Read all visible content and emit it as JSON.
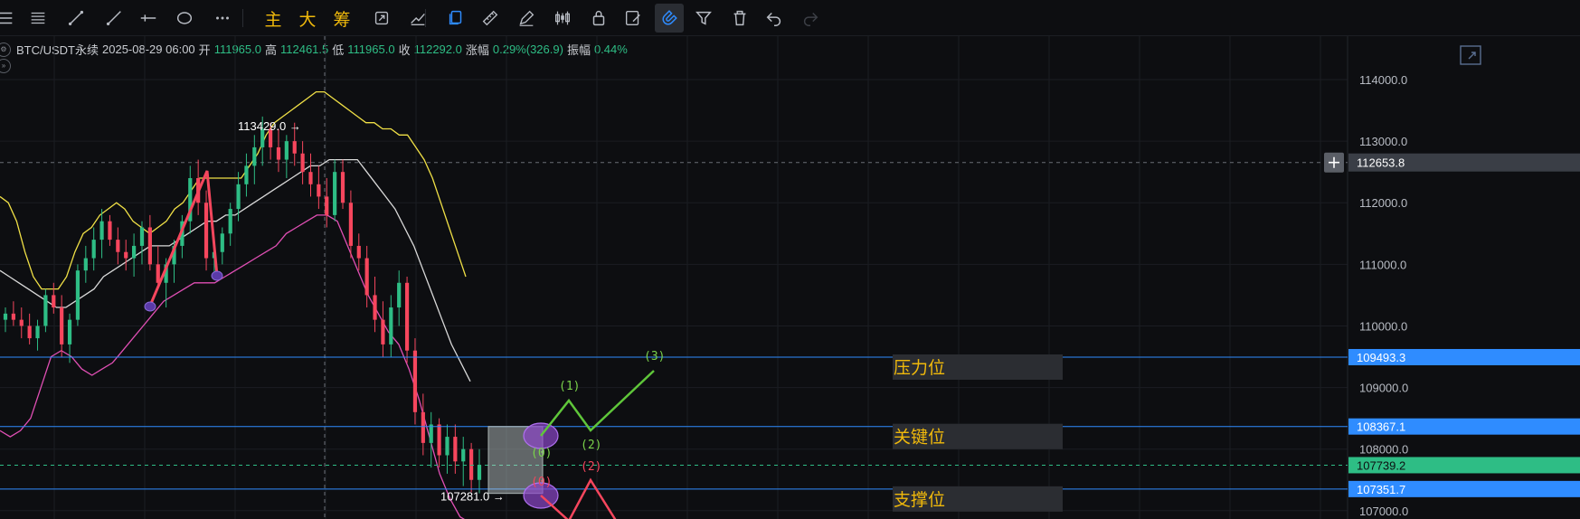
{
  "toolbar": {
    "tools": [
      {
        "name": "menu-icon"
      },
      {
        "name": "hlines-icon"
      },
      {
        "name": "trendline-icon"
      },
      {
        "name": "ray-icon"
      },
      {
        "name": "crosshair-line-icon"
      },
      {
        "name": "ellipse-icon"
      },
      {
        "name": "more-icon"
      },
      {
        "name": "main-indicator-button",
        "label": "主"
      },
      {
        "name": "big-button",
        "label": "大"
      },
      {
        "name": "chip-button",
        "label": "筹"
      },
      {
        "name": "replay-icon"
      },
      {
        "name": "measure-icon"
      },
      {
        "name": "copy-icon"
      },
      {
        "name": "ruler-icon"
      },
      {
        "name": "pencil-icon"
      },
      {
        "name": "candles-icon"
      },
      {
        "name": "lock-icon"
      },
      {
        "name": "edit-icon"
      },
      {
        "name": "magnet-icon"
      },
      {
        "name": "filter-icon"
      },
      {
        "name": "trash-icon"
      },
      {
        "name": "undo-icon"
      },
      {
        "name": "redo-icon"
      }
    ]
  },
  "info": {
    "symbol": "BTC/USDT永续",
    "datetime": "2025-08-29 06:00",
    "open_label": "开",
    "open": "111965.0",
    "high_label": "高",
    "high": "112461.5",
    "low_label": "低",
    "low": "111965.0",
    "close_label": "收",
    "close": "112292.0",
    "change_label": "涨幅",
    "change": "0.29%(326.9)",
    "amp_label": "振幅",
    "amp": "0.44%"
  },
  "colors": {
    "up": "#2ebd85",
    "down": "#f6465d",
    "accent": "#2f8cff",
    "boll_upper": "#f0e046",
    "boll_mid": "#d9d9d9",
    "boll_lower": "#e04fb4",
    "zone_label": "#f0b90b",
    "bg": "#0d0e11"
  },
  "chart_data": {
    "type": "candlestick",
    "y_ticks": [
      114000,
      113000,
      112000,
      111000,
      110000,
      109000,
      108000,
      107000
    ],
    "y_tick_labels": [
      "114000.0",
      "113000.0",
      "112000.0",
      "111000.0",
      "110000.0",
      "109000.0",
      "108000.0",
      "107000.0"
    ],
    "ylim": [
      106865,
      114705
    ],
    "crosshair_price": "112653.8",
    "price_tags": [
      {
        "value": 109493.3,
        "label": "109493.3",
        "type": "line"
      },
      {
        "value": 108367.1,
        "label": "108367.1",
        "type": "line"
      },
      {
        "value": 107739.2,
        "label": "107739.2",
        "type": "current"
      },
      {
        "value": 107351.7,
        "label": "107351.7",
        "type": "line"
      }
    ],
    "zones": [
      {
        "value": 109493.3,
        "label": "压力位"
      },
      {
        "value": 108367.1,
        "label": "关键位"
      },
      {
        "value": 107351.7,
        "label": "支撑位"
      }
    ],
    "annotations": [
      {
        "text": "113429.0 →",
        "price": 113429.0
      },
      {
        "text": "107281.0 →",
        "price": 107281.0
      }
    ],
    "wave_green": [
      "(0)",
      "(1)",
      "(2)",
      "(3)"
    ],
    "wave_red": [
      "(0)",
      "(2)"
    ],
    "upper_band": [
      112100,
      112000,
      111700,
      111200,
      110800,
      110600,
      110600,
      110600,
      110800,
      111200,
      111500,
      111600,
      111800,
      111900,
      112000,
      111900,
      111700,
      111600,
      111500,
      111600,
      111700,
      111900,
      112000,
      112200,
      112400,
      112400,
      112400,
      112400,
      112400,
      112400,
      112600,
      112800,
      113100,
      113300,
      113400,
      113500,
      113600,
      113700,
      113800,
      113800,
      113700,
      113600,
      113500,
      113400,
      113300,
      113300,
      113200,
      113200,
      113100,
      113100,
      112900,
      112700,
      112400,
      112000,
      111600,
      111200,
      110800
    ],
    "middle_band": [
      110900,
      110800,
      110700,
      110600,
      110500,
      110400,
      110300,
      110300,
      110400,
      110500,
      110600,
      110800,
      110900,
      111000,
      111100,
      111200,
      111300,
      111300,
      111300,
      111400,
      111500,
      111600,
      111700,
      111700,
      111800,
      111800,
      111900,
      112000,
      112100,
      112200,
      112300,
      112400,
      112500,
      112600,
      112600,
      112700,
      112700,
      112700,
      112700,
      112500,
      112300,
      112100,
      111900,
      111600,
      111300,
      110900,
      110500,
      110100,
      109700,
      109400,
      109100
    ],
    "lower_band": [
      108300,
      108200,
      108300,
      108500,
      109000,
      109500,
      109600,
      109500,
      109300,
      109200,
      109300,
      109400,
      109600,
      109800,
      110000,
      110200,
      110400,
      110500,
      110600,
      110700,
      110700,
      110700,
      110800,
      110900,
      111000,
      111100,
      111200,
      111300,
      111500,
      111600,
      111700,
      111800,
      111800,
      111700,
      111300,
      110900,
      110500,
      110200,
      109900,
      109700,
      109300,
      108800,
      108200,
      107600,
      107200,
      106900,
      106800
    ],
    "candles": [
      [
        110100,
        110300,
        109900,
        110200
      ],
      [
        110200,
        110400,
        110000,
        110100
      ],
      [
        110100,
        110300,
        109800,
        110000
      ],
      [
        110000,
        110200,
        109700,
        109800
      ],
      [
        109800,
        110100,
        109600,
        110000
      ],
      [
        110000,
        110600,
        109900,
        110500
      ],
      [
        110500,
        110700,
        110200,
        110300
      ],
      [
        110300,
        110500,
        109500,
        109700
      ],
      [
        109700,
        110200,
        109400,
        110100
      ],
      [
        110100,
        111000,
        110000,
        110900
      ],
      [
        110900,
        111300,
        110700,
        111100
      ],
      [
        111100,
        111600,
        110900,
        111400
      ],
      [
        111400,
        111900,
        111100,
        111700
      ],
      [
        111700,
        111800,
        111300,
        111400
      ],
      [
        111400,
        111600,
        111000,
        111200
      ],
      [
        111200,
        111400,
        110900,
        111100
      ],
      [
        111100,
        111500,
        110800,
        111300
      ],
      [
        111300,
        111700,
        111000,
        111600
      ],
      [
        111600,
        111800,
        110900,
        111000
      ],
      [
        111000,
        111300,
        110600,
        110700
      ],
      [
        110700,
        111100,
        110300,
        111000
      ],
      [
        111000,
        111400,
        110700,
        111300
      ],
      [
        111300,
        111800,
        111100,
        111700
      ],
      [
        111700,
        112600,
        111500,
        112400
      ],
      [
        112400,
        112700,
        111800,
        112000
      ],
      [
        112000,
        112200,
        110900,
        111100
      ],
      [
        111100,
        111400,
        110800,
        111200
      ],
      [
        111200,
        111600,
        111000,
        111500
      ],
      [
        111500,
        112000,
        111300,
        111900
      ],
      [
        111900,
        112500,
        111700,
        112300
      ],
      [
        112300,
        112800,
        112100,
        112600
      ],
      [
        112600,
        113100,
        112300,
        112900
      ],
      [
        112900,
        113400,
        112600,
        113200
      ],
      [
        113200,
        113300,
        112700,
        112900
      ],
      [
        112900,
        113200,
        112500,
        112700
      ],
      [
        112700,
        113100,
        112400,
        113000
      ],
      [
        113000,
        113300,
        112600,
        112800
      ],
      [
        112800,
        113000,
        112300,
        112500
      ],
      [
        112500,
        112800,
        112100,
        112300
      ],
      [
        112300,
        112600,
        111900,
        112100
      ],
      [
        112100,
        112400,
        111600,
        111800
      ],
      [
        111800,
        112700,
        111700,
        112500
      ],
      [
        112500,
        112700,
        111900,
        112000
      ],
      [
        112000,
        112200,
        111100,
        111300
      ],
      [
        111300,
        111500,
        110900,
        111100
      ],
      [
        111100,
        111300,
        110300,
        110500
      ],
      [
        110500,
        110800,
        109900,
        110100
      ],
      [
        110100,
        110400,
        109500,
        109700
      ],
      [
        109700,
        110500,
        109500,
        110300
      ],
      [
        110300,
        110900,
        110000,
        110700
      ],
      [
        110700,
        110800,
        109400,
        109600
      ],
      [
        109600,
        109800,
        108400,
        108600
      ],
      [
        108600,
        108900,
        107900,
        108100
      ],
      [
        108100,
        108600,
        107700,
        108400
      ],
      [
        108400,
        108500,
        107700,
        107900
      ],
      [
        107900,
        108400,
        107600,
        108200
      ],
      [
        108200,
        108400,
        107600,
        107800
      ],
      [
        107800,
        108200,
        107400,
        108000
      ],
      [
        108000,
        108100,
        107300,
        107500
      ],
      [
        107500,
        108000,
        107281,
        107739
      ]
    ]
  }
}
